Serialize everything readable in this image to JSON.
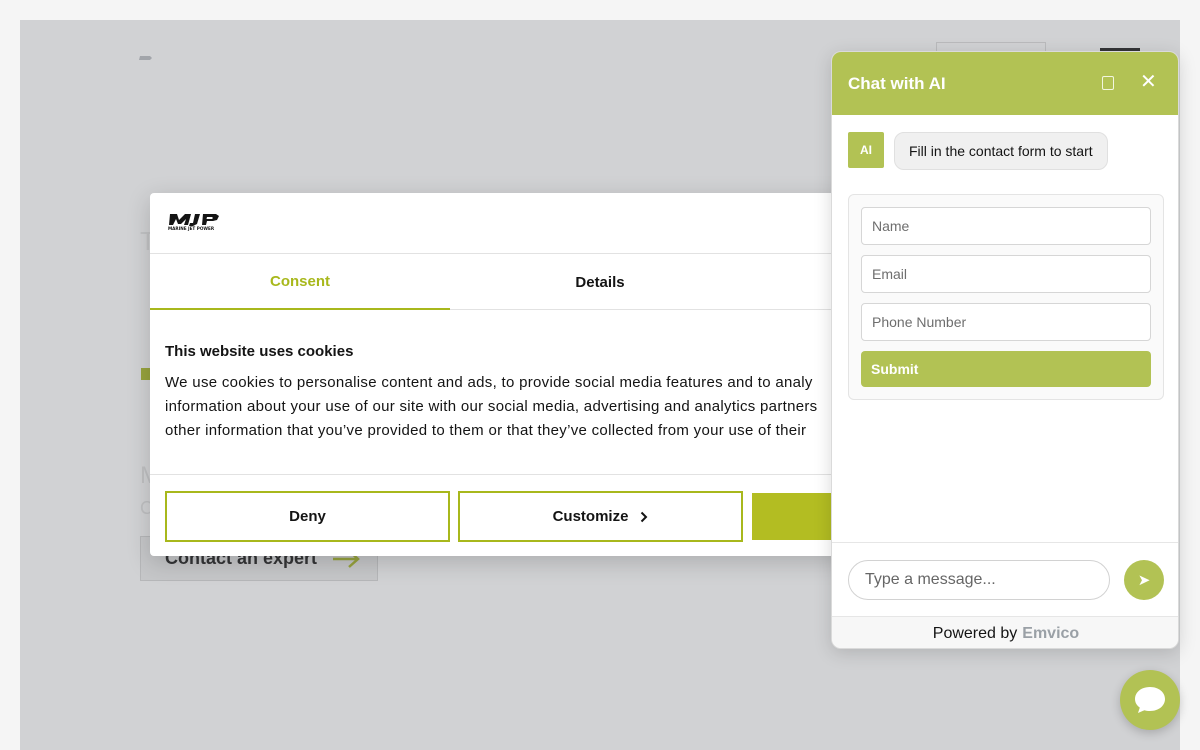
{
  "brand": {
    "logo_mark": "MJP",
    "logo_text": "MARINE JET POWER"
  },
  "hero": {
    "heading_fragment": "T",
    "subheading_fragment": "M",
    "line_fragment": "C",
    "cta_label": "Contact an expert"
  },
  "cookie": {
    "tabs": [
      {
        "label": "Consent",
        "active": true
      },
      {
        "label": "Details",
        "active": false
      }
    ],
    "title": "This website uses cookies",
    "text_lines": [
      "We use cookies to personalise content and ads, to provide social media features and to analy",
      "information about your use of our site with our social media, advertising and analytics partners",
      "other information that you’ve provided to them or that they’ve collected from your use of their"
    ],
    "buttons": {
      "deny": "Deny",
      "customize": "Customize",
      "allow": ""
    }
  },
  "chat": {
    "title": "Chat with AI",
    "avatar_label": "AI",
    "greeting": "Fill in the contact form to start",
    "form": {
      "name_placeholder": "Name",
      "email_placeholder": "Email",
      "phone_placeholder": "Phone Number",
      "submit_label": "Submit"
    },
    "message_placeholder": "Type a message...",
    "send_icon": "send-icon",
    "powered_by": "Powered by",
    "powered_brand": "Emvico"
  },
  "colors": {
    "accent": "#a8b81c",
    "chat_accent": "#b2c254",
    "text": "#141414"
  }
}
